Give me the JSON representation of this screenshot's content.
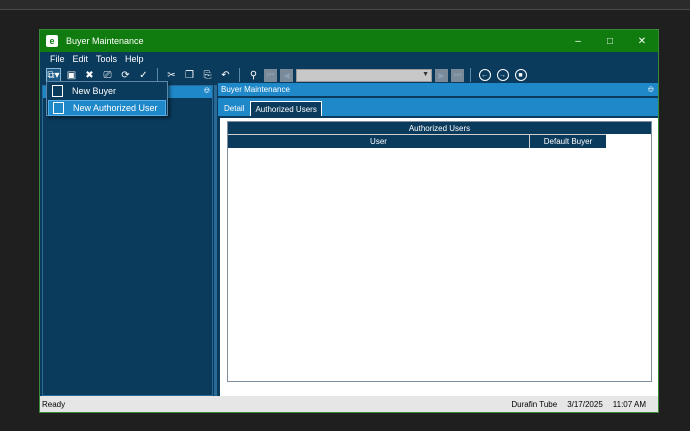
{
  "window": {
    "title": "Buyer Maintenance",
    "app_icon": "e",
    "controls": [
      "minimize-icon",
      "maximize-icon",
      "close-icon"
    ]
  },
  "menu": [
    "File",
    "Edit",
    "Tools",
    "Help"
  ],
  "toolbar": {
    "icons": [
      "new-icon",
      "save-icon",
      "delete-icon",
      "print-icon",
      "refresh-icon",
      "clear-icon",
      "cut-icon",
      "copy-icon",
      "paste-icon",
      "undo-icon",
      "search-icon",
      "first-record-icon",
      "previous-record-icon",
      "next-record-icon",
      "last-record-icon",
      "back-icon",
      "forward-icon",
      "stop-icon"
    ],
    "record_combo_value": ""
  },
  "new_menu": {
    "items": [
      {
        "label": "New Buyer",
        "icon": "document-icon",
        "selected": false
      },
      {
        "label": "New Authorized User",
        "icon": "document-icon",
        "selected": true
      }
    ]
  },
  "right_pane": {
    "header": "Buyer Maintenance",
    "tabs": [
      {
        "label": "Detail",
        "active": false
      },
      {
        "label": "Authorized Users",
        "active": true
      }
    ],
    "grid": {
      "title": "Authorized Users",
      "columns": [
        "User",
        "Default Buyer"
      ],
      "rows": []
    }
  },
  "status": {
    "text": "Ready",
    "company": "Durafin Tube",
    "date": "3/17/2025",
    "time": "11:07 AM"
  }
}
